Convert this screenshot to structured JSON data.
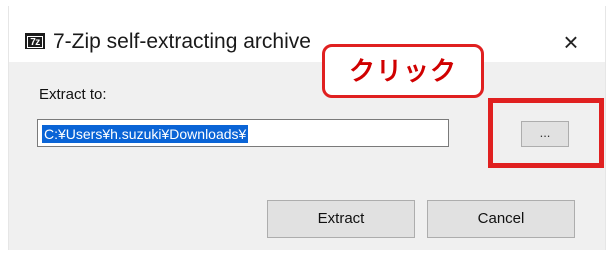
{
  "window": {
    "icon_text": "7z",
    "title": "7-Zip self-extracting archive",
    "close_glyph": "×"
  },
  "form": {
    "label": "Extract to:",
    "path_value": "C:¥Users¥h.suzuki¥Downloads¥",
    "browse_label": "..."
  },
  "buttons": {
    "extract": "Extract",
    "cancel": "Cancel"
  },
  "annotation": {
    "callout_text": "クリック",
    "color": "#e02020"
  },
  "colors": {
    "selection": "#0a64d6",
    "dialog_body": "#f0f0f0",
    "button_face": "#e1e1e1"
  }
}
